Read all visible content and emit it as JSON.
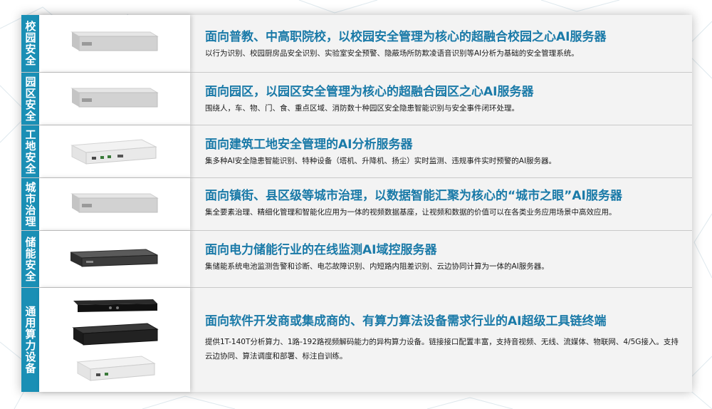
{
  "rows": [
    {
      "tag": "校园安全",
      "title": "面向普教、中高职院校，以校园安全管理为核心的超融合校园之心AI服务器",
      "desc": "以行为识别、校园厨房品安全识别、实验室安全预警、隐蔽场所防欺凌语音识别等AI分析为基础的安全管理系统。",
      "device": "silver-1u"
    },
    {
      "tag": "园区安全",
      "title": "面向园区，以园区安全管理为核心的超融合园区之心AI服务器",
      "desc": "围绕人，车、物、门、食、重点区域、消防数十种园区安全隐患智能识别与安全事件闭环处理。",
      "device": "silver-1u"
    },
    {
      "tag": "工地安全",
      "title": "面向建筑工地安全管理的AI分析服务器",
      "desc": "集多种AI安全隐患智能识别、特种设备（塔机、升降机、扬尘）实时监测、违规事件实时预警的AI服务器。",
      "device": "white-box"
    },
    {
      "tag": "城市治理",
      "title": "面向镇街、县区级等城市治理，以数据智能汇聚为核心的“城市之眼”AI服务器",
      "desc": "集全要素治理、精细化管理和智能化应用为一体的视频数据基座，让视频和数据的价值可以在各类业务应用场景中高效应用。",
      "device": "silver-1u"
    },
    {
      "tag": "储能安全",
      "title": "面向电力储能行业的在线监测AI域控服务器",
      "desc": "集储能系统电池监测告警和诊断、电芯故障识别、内短路内阻差识别、云边协同计算为一体的AI服务器。",
      "device": "dark-1u"
    },
    {
      "tag": "通用算力设备",
      "title": "面向软件开发商或集成商的、有算力算法设备需求行业的AI超级工具链终端",
      "desc": "提供1T-140T分析算力、1路-192路视频解码能力的异构算力设备。链接接口配置丰富，支持音视频、无线、流媒体、物联网、4/5G接入。支持云边协同、算法调度和部署、标注自训练。",
      "device": "multi"
    }
  ],
  "colors": {
    "accent": "#1a8fb5",
    "title": "#1a7aa8",
    "panel": "#f3f3f3"
  }
}
